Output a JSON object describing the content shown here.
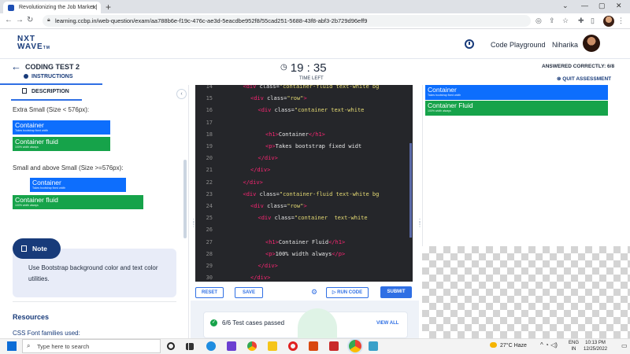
{
  "browser": {
    "tab_title": "Revolutionizing the Job Market |",
    "url": "learning.ccbp.in/web-question/exam/aa788b6e-f19c-476c-ae3d-5eacdbe952f8/55cad251-5688-43f8-abf3-2b729d96eff9"
  },
  "header": {
    "logo_line1": "NXT",
    "logo_line2": "WAVE",
    "logo_tm": "TM",
    "playground": "Code Playground",
    "username": "Niharika"
  },
  "testbar": {
    "title": "CODING TEST 2",
    "instructions": "INSTRUCTIONS",
    "timer": "19 : 35",
    "time_left": "TIME LEFT",
    "answered": "ANSWERED CORRECTLY: 6/8",
    "quit": "QUIT ASSESSMENT"
  },
  "left": {
    "tab": "DESCRIPTION",
    "xs_label": "Extra Small (Size < 576px):",
    "sm_label": "Small and above Small (Size >=576px):",
    "container_heading": "Container",
    "container_text": "Takes bootstrap fixed width",
    "fluid_heading": "Container fluid",
    "fluid_text": "100% width always",
    "note_title": "Note",
    "note_text": "Use Bootstrap background color and text color utilities.",
    "resources": "Resources",
    "css_fonts": "CSS Font families used:"
  },
  "editor": {
    "lines": [
      {
        "n": "14",
        "indent": 3,
        "html": "<div class=\"container-fluid text-white bg"
      },
      {
        "n": "15",
        "indent": 4,
        "html": "<div class=\"row\">"
      },
      {
        "n": "16",
        "indent": 5,
        "html": "<div class=\"container text-white"
      },
      {
        "n": "17",
        "indent": 0,
        "html": ""
      },
      {
        "n": "18",
        "indent": 6,
        "html": "<h1>Container</h1>"
      },
      {
        "n": "19",
        "indent": 6,
        "html": "<p>Takes bootstrap fixed widt"
      },
      {
        "n": "20",
        "indent": 5,
        "html": "</div>"
      },
      {
        "n": "21",
        "indent": 4,
        "html": "</div>"
      },
      {
        "n": "22",
        "indent": 3,
        "html": "</div>"
      },
      {
        "n": "23",
        "indent": 3,
        "html": "<div class=\"container-fluid text-white bg"
      },
      {
        "n": "24",
        "indent": 4,
        "html": "<div class=\"row\">"
      },
      {
        "n": "25",
        "indent": 5,
        "html": "<div class=\"container  text-white"
      },
      {
        "n": "26",
        "indent": 0,
        "html": ""
      },
      {
        "n": "27",
        "indent": 6,
        "html": "<h1>Container Fluid</h1>"
      },
      {
        "n": "28",
        "indent": 6,
        "html": "<p>100% width always</p>"
      },
      {
        "n": "29",
        "indent": 5,
        "html": "</div>"
      },
      {
        "n": "30",
        "indent": 4,
        "html": "</div>"
      }
    ]
  },
  "toolbar": {
    "reset": "RESET",
    "save": "SAVE",
    "run": "RUN CODE",
    "submit": "SUBMIT"
  },
  "tests": {
    "passed": "6/6 Test cases passed",
    "view_all": "VIEW ALL"
  },
  "preview": {
    "container_heading": "Container",
    "container_text": "Takes bootstrap fixed width",
    "fluid_heading": "Container Fluid",
    "fluid_text": "100% width always"
  },
  "taskbar": {
    "search": "Type here to search",
    "weather": "27°C  Haze",
    "lang1": "ENG",
    "lang2": "IN",
    "time": "10:13 PM",
    "date": "12/25/2022"
  },
  "colors": {
    "blue": "#0d6efd",
    "green": "#16a34a",
    "brand": "#183b7a",
    "accent": "#2f6fe4"
  }
}
